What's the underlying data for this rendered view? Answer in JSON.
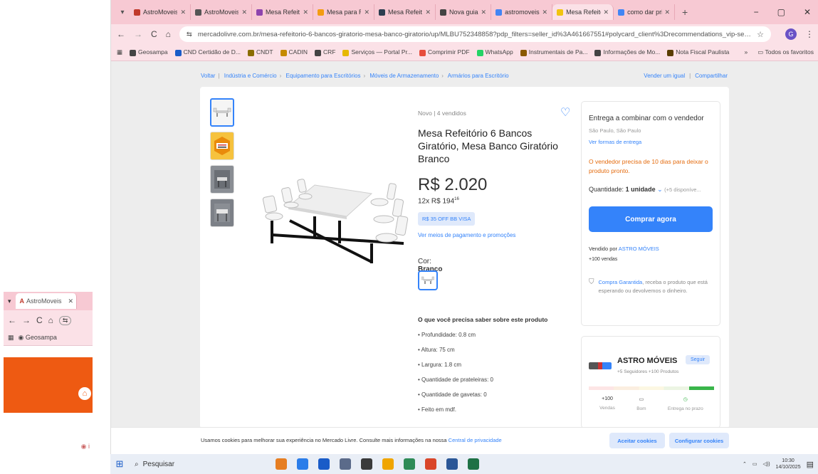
{
  "left_window": {
    "tab_label": "AstroMoveis",
    "bookmark": "Geosampa"
  },
  "browser": {
    "tabs": [
      {
        "label": "AstroMoveis |",
        "color": "#c0392b"
      },
      {
        "label": "AstroMoveis |",
        "color": "#555555"
      },
      {
        "label": "Mesa Refeitó",
        "color": "#8e44ad"
      },
      {
        "label": "Mesa para Re",
        "color": "#f39c12"
      },
      {
        "label": "Mesa Refeitó",
        "color": "#2c3e50"
      },
      {
        "label": "Nova guia",
        "color": "#444444"
      },
      {
        "label": "astromoveis",
        "color": "#4285f4"
      },
      {
        "label": "Mesa Refeitó",
        "color": "#f1c40f",
        "active": true
      },
      {
        "label": "como dar pri",
        "color": "#4285f4"
      }
    ],
    "new_tab": "+",
    "window_controls": [
      "−",
      "▢",
      "✕"
    ],
    "url": "mercadolivre.com.br/mesa-refeitorio-6-bancos-giratorio-mesa-banco-giratorio/up/MLBU752348858?pdp_filters=seller_id%3A461667551#polycard_client%3Drecommendations_vip-seller_items-ashops...",
    "bookmarks": [
      {
        "label": "Geosampa",
        "color": "#444"
      },
      {
        "label": "CND Certidão de D...",
        "color": "#1a5cc8"
      },
      {
        "label": "CNDT",
        "color": "#8a6d00"
      },
      {
        "label": "CADIN",
        "color": "#c58a00"
      },
      {
        "label": "CRF",
        "color": "#444"
      },
      {
        "label": "Serviços — Portal Pr...",
        "color": "#e6b800"
      },
      {
        "label": "Comprimir PDF",
        "color": "#e74c3c"
      },
      {
        "label": "WhatsApp",
        "color": "#25d366"
      },
      {
        "label": "Instrumentais de Pa...",
        "color": "#8a5a00"
      },
      {
        "label": "Informações de Mo...",
        "color": "#444"
      },
      {
        "label": "Nota Fiscal Paulista",
        "color": "#5a3d00"
      }
    ],
    "bookmarks_more": "»",
    "all_favorites": "Todos os favoritos"
  },
  "breadcrumb": {
    "back": "Voltar",
    "items": [
      "Indústria e Comércio",
      "Equipamento para Escritórios",
      "Móveis de Armazenamento",
      "Armários para Escritório"
    ],
    "sell_same": "Vender um igual",
    "share": "Compartilhar"
  },
  "product": {
    "condition": "Novo  |  4 vendidos",
    "title": "Mesa Refeitório 6 Bancos Giratório, Mesa Banco Giratório Branco",
    "price": "R$ 2.020",
    "installments": "12x R$ 194",
    "installments_cents": "16",
    "promo": "R$ 35 OFF BB VISA",
    "payment_link": "Ver meios de pagamento e promoções",
    "color_label": "Cor:",
    "color_value": "Branco",
    "features_title": "O que você precisa saber sobre este produto",
    "features": [
      "Profundidade: 0.8 cm",
      "Altura: 75 cm",
      "Largura: 1.8 cm",
      "Quantidade de prateleiras: 0",
      "Quantidade de gavetas: 0",
      "Feito em mdf."
    ]
  },
  "purchase": {
    "delivery": "Entrega a combinar com o vendedor",
    "location": "São Paulo, São Paulo",
    "delivery_link": "Ver formas de entrega",
    "notice": "O vendedor precisa de 10 dias para deixar o produto pronto.",
    "quantity_label": "Quantidade:",
    "quantity_value": "1 unidade",
    "quantity_available": "(+5 disponíve...",
    "buy_button": "Comprar agora",
    "sold_by_label": "Vendido por",
    "sold_by": "ASTRO MÓVEIS",
    "sales": "+100 vendas",
    "guarantee_link": "Compra Garantida",
    "guarantee_text": ", receba o produto que está esperando ou devolvemos o dinheiro."
  },
  "seller": {
    "name": "ASTRO MÓVEIS",
    "follow": "Seguir",
    "followers": "+5 Seguidores",
    "products": "+100 Produtos",
    "stats": [
      {
        "value": "+100",
        "label": "Vendas"
      },
      {
        "value": "",
        "label": "Bom"
      },
      {
        "value": "",
        "label": "Entrega no prazo"
      }
    ]
  },
  "cookies": {
    "text": "Usamos cookies para melhorar sua experiência no Mercado Livre. Consulte mais informações na nossa ",
    "link": "Central de privacidade",
    "accept": "Aceitar cookies",
    "configure": "Configurar cookies"
  },
  "taskbar": {
    "search": "Pesquisar",
    "apps": [
      "#e67e22",
      "#2b7de9",
      "#1a5cc8",
      "#5b6b8a",
      "#3a3a3a",
      "#f0a500",
      "#2e8b57",
      "#d9462a",
      "#2b5797",
      "#1e7145"
    ],
    "time": "10:30",
    "date": "14/10/2025"
  }
}
